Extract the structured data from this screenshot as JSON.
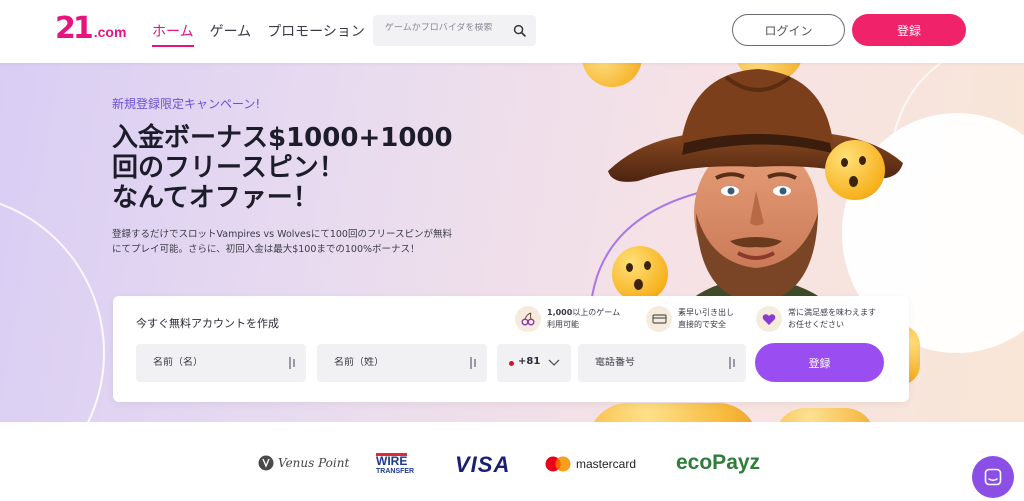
{
  "header": {
    "logo_mark": "21",
    "logo_suffix": ".com",
    "nav": [
      {
        "label": "ホーム",
        "active": true
      },
      {
        "label": "ゲーム",
        "active": false
      },
      {
        "label": "プロモーション",
        "active": false
      }
    ],
    "search_placeholder": "ゲームかプロバイダを検索",
    "login_label": "ログイン",
    "register_label": "登録"
  },
  "hero": {
    "tag": "新規登録限定キャンペーン!",
    "title_lines": [
      "入金ボーナス$1000+1000",
      "回のフリースピン！",
      "なんてオファー！"
    ],
    "description": "登録するだけでスロットVampires vs Wolvesにて100回のフリースピンが無料にてプレイ可能。さらに、初回入金は最大$100までの100%ボーナス！"
  },
  "signup": {
    "title": "今すぐ無料アカウントを作成",
    "features": [
      {
        "icon": "cherries-icon",
        "bold": "1,000",
        "text1": "以上のゲーム",
        "text2": "利用可能"
      },
      {
        "icon": "card-icon",
        "bold": "",
        "text1": "素早い引き出し",
        "text2": "直接的で安全"
      },
      {
        "icon": "heart-icon",
        "bold": "",
        "text1": "常に満足感を味わえます",
        "text2": "お任せください"
      }
    ],
    "first_name_placeholder": "名前（名）",
    "last_name_placeholder": "名前（姓）",
    "country_code": "+81",
    "phone_placeholder": "電話番号",
    "register_label": "登録"
  },
  "payments": {
    "venus_point": "Venus Point",
    "wire_top": "WIRE",
    "wire_bottom": "TRANSFER",
    "visa": "VISA",
    "mastercard": "mastercard",
    "ecopayz": "ecoPayz"
  },
  "colors": {
    "brand_pink": "#f0226a",
    "brand_purple": "#9a4ef1",
    "accent_violet": "#6b4fd8"
  }
}
